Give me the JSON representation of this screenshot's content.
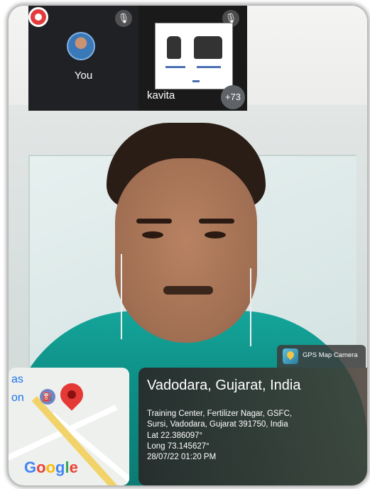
{
  "call": {
    "self_label": "You",
    "presenter_label": "kavita",
    "more_participants": "+73",
    "mute_icon": "mic-off-icon",
    "record_icon": "recording-icon"
  },
  "watermark": {
    "app_name": "GPS Map Camera",
    "place": "Vadodara, Gujarat, India",
    "address": "Training Center, Fertilizer Nagar, GSFC,\nSursi, Vadodara, Gujarat 391750, India",
    "lat": "Lat 22.386097°",
    "long": "Long 73.145627°",
    "datetime": "28/07/22 01:20 PM"
  },
  "map": {
    "label_1": "as",
    "label_2": "on",
    "poi_icon": "gas-station-icon",
    "pin_icon": "map-pin-icon",
    "brand": "Google"
  },
  "colors": {
    "recording": "#e33b3b",
    "pin": "#e53935",
    "shirt": "#14a59a"
  }
}
